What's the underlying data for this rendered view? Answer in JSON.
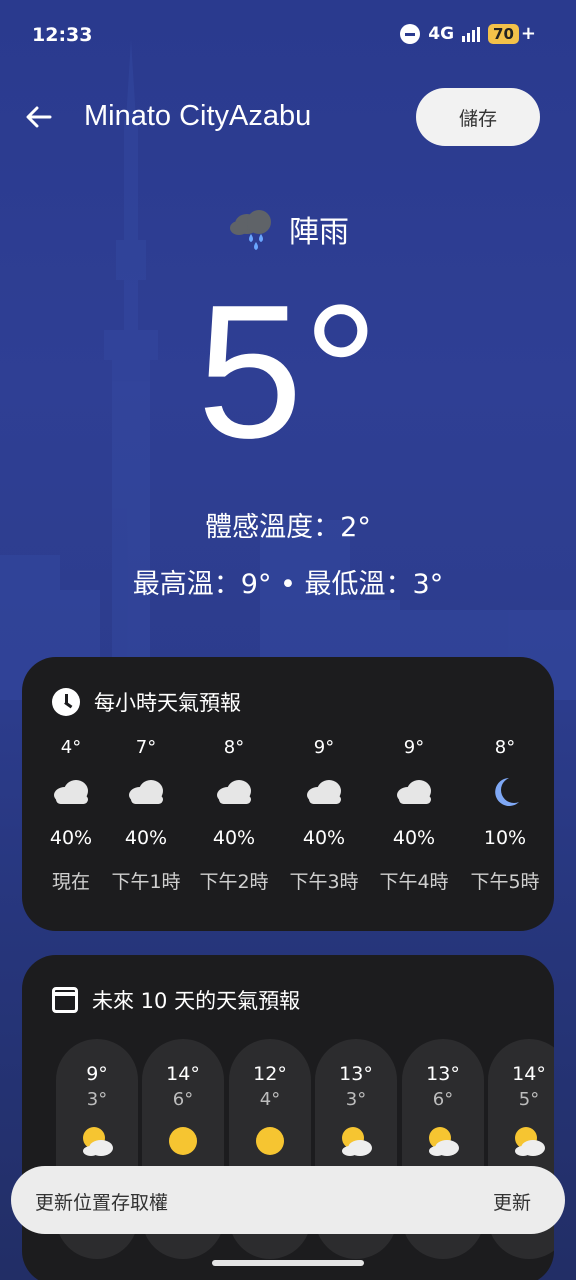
{
  "status_bar": {
    "time": "12:33",
    "network": "4G",
    "battery": "70",
    "battery_plus": "+",
    "icons": [
      "do-not-disturb-icon",
      "signal-icon",
      "battery-icon"
    ]
  },
  "header": {
    "location": "Minato CityAzabu",
    "save_label": "儲存",
    "back_icon": "arrow-left-icon"
  },
  "current": {
    "condition": "陣雨",
    "condition_icon": "rain-cloud-icon",
    "temperature": "5°",
    "feels_like": "體感溫度：2°",
    "high_low": "最高溫：9° • 最低溫：3°"
  },
  "hourly": {
    "title": "每小時天氣預報",
    "icon": "clock-icon",
    "items": [
      {
        "temp": "4°",
        "icon": "cloud-icon",
        "prob": "40%",
        "time": "現在"
      },
      {
        "temp": "7°",
        "icon": "cloud-icon",
        "prob": "40%",
        "time": "下午1時"
      },
      {
        "temp": "8°",
        "icon": "cloud-icon",
        "prob": "40%",
        "time": "下午2時"
      },
      {
        "temp": "9°",
        "icon": "cloud-icon",
        "prob": "40%",
        "time": "下午3時"
      },
      {
        "temp": "9°",
        "icon": "cloud-icon",
        "prob": "40%",
        "time": "下午4時"
      },
      {
        "temp": "8°",
        "icon": "moon-icon",
        "prob": "10%",
        "time": "下午5時"
      }
    ]
  },
  "daily": {
    "title": "未來 10 天的天氣預報",
    "icon": "calendar-icon",
    "items": [
      {
        "hi": "9°",
        "lo": "3°",
        "icon": "partly-cloudy-icon"
      },
      {
        "hi": "14°",
        "lo": "6°",
        "icon": "sun-icon"
      },
      {
        "hi": "12°",
        "lo": "4°",
        "icon": "sun-icon"
      },
      {
        "hi": "13°",
        "lo": "3°",
        "icon": "partly-cloudy-icon"
      },
      {
        "hi": "13°",
        "lo": "6°",
        "icon": "partly-cloudy-icon"
      },
      {
        "hi": "14°",
        "lo": "5°",
        "icon": "partly-cloudy-icon"
      }
    ]
  },
  "snackbar": {
    "text": "更新位置存取權",
    "action": "更新"
  },
  "colors": {
    "background": "#2c3c8c",
    "card": "#1c1c1e",
    "sun": "#f6c531",
    "moon": "#7fa8f5",
    "rain": "#6aa6ff"
  }
}
